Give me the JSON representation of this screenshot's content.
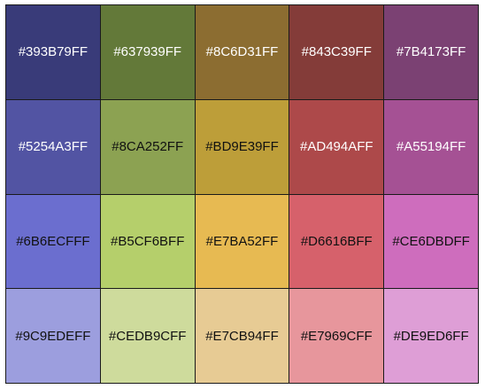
{
  "swatches": [
    {
      "label": "#393B79FF",
      "color": "#393B79",
      "text_color": "#ffffff"
    },
    {
      "label": "#637939FF",
      "color": "#637939",
      "text_color": "#ffffff"
    },
    {
      "label": "#8C6D31FF",
      "color": "#8C6D31",
      "text_color": "#ffffff"
    },
    {
      "label": "#843C39FF",
      "color": "#843C39",
      "text_color": "#ffffff"
    },
    {
      "label": "#7B4173FF",
      "color": "#7B4173",
      "text_color": "#ffffff"
    },
    {
      "label": "#5254A3FF",
      "color": "#5254A3",
      "text_color": "#ffffff"
    },
    {
      "label": "#8CA252FF",
      "color": "#8CA252",
      "text_color": "#111111"
    },
    {
      "label": "#BD9E39FF",
      "color": "#BD9E39",
      "text_color": "#111111"
    },
    {
      "label": "#AD494AFF",
      "color": "#AD494A",
      "text_color": "#ffffff"
    },
    {
      "label": "#A55194FF",
      "color": "#A55194",
      "text_color": "#ffffff"
    },
    {
      "label": "#6B6ECFFF",
      "color": "#6B6ECF",
      "text_color": "#111111"
    },
    {
      "label": "#B5CF6BFF",
      "color": "#B5CF6B",
      "text_color": "#111111"
    },
    {
      "label": "#E7BA52FF",
      "color": "#E7BA52",
      "text_color": "#111111"
    },
    {
      "label": "#D6616BFF",
      "color": "#D6616B",
      "text_color": "#111111"
    },
    {
      "label": "#CE6DBDFF",
      "color": "#CE6DBD",
      "text_color": "#111111"
    },
    {
      "label": "#9C9EDEFF",
      "color": "#9C9EDE",
      "text_color": "#111111"
    },
    {
      "label": "#CEDB9CFF",
      "color": "#CEDB9C",
      "text_color": "#111111"
    },
    {
      "label": "#E7CB94FF",
      "color": "#E7CB94",
      "text_color": "#111111"
    },
    {
      "label": "#E7969CFF",
      "color": "#E7969C",
      "text_color": "#111111"
    },
    {
      "label": "#DE9ED6FF",
      "color": "#DE9ED6",
      "text_color": "#111111"
    }
  ]
}
